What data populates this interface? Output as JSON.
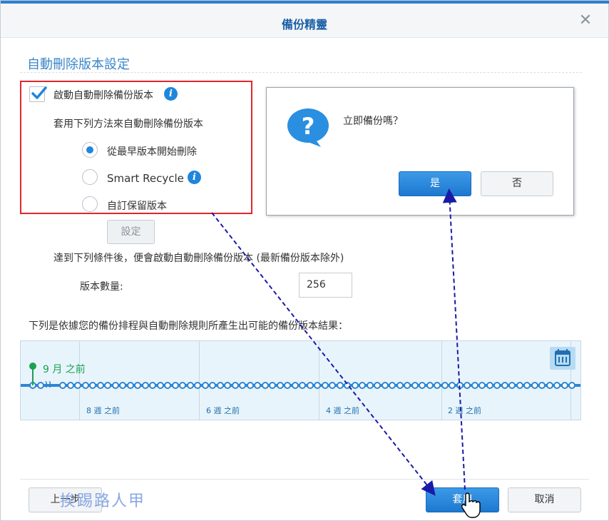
{
  "window": {
    "title": "備份精靈",
    "close_glyph": "✕"
  },
  "section": {
    "title": "自動刪除版本設定"
  },
  "rotation": {
    "enable_label": "啟動自動刪除備份版本",
    "enabled": true,
    "method_prompt": "套用下列方法來自動刪除備份版本",
    "options": [
      {
        "label": "從最早版本開始刪除",
        "selected": true
      },
      {
        "label": "Smart Recycle",
        "selected": false
      },
      {
        "label": "自訂保留版本",
        "selected": false
      }
    ],
    "settings_button": "設定",
    "condition_text": "達到下列條件後，便會啟動自動刪除備份版本 (最新備份版本除外)",
    "version_count_label": "版本數量:",
    "version_count_value": "256"
  },
  "timeline": {
    "caption": "下列是依據您的備份排程與自動刪除規則所產生出可能的備份版本結果：",
    "pin_label": "9 月 之前",
    "week_labels": [
      "8 週 之前",
      "6 週 之前",
      "4 週 之前",
      "2 週 之前"
    ],
    "calendar_icon": "calendar-icon"
  },
  "confirm_dialog": {
    "message": "立即備份嗎？",
    "yes_label": "是",
    "no_label": "否",
    "icon": "question-icon"
  },
  "footer": {
    "back_label": "上一步",
    "apply_label": "套用",
    "cancel_label": "取消",
    "watermark": "挨踢路人甲"
  },
  "colors": {
    "accent": "#1f86db",
    "title_text": "#1a5fa6",
    "highlight_box": "#e0262c",
    "annotation_arrow": "#1a1aa8",
    "pin_green": "#1aa152"
  }
}
